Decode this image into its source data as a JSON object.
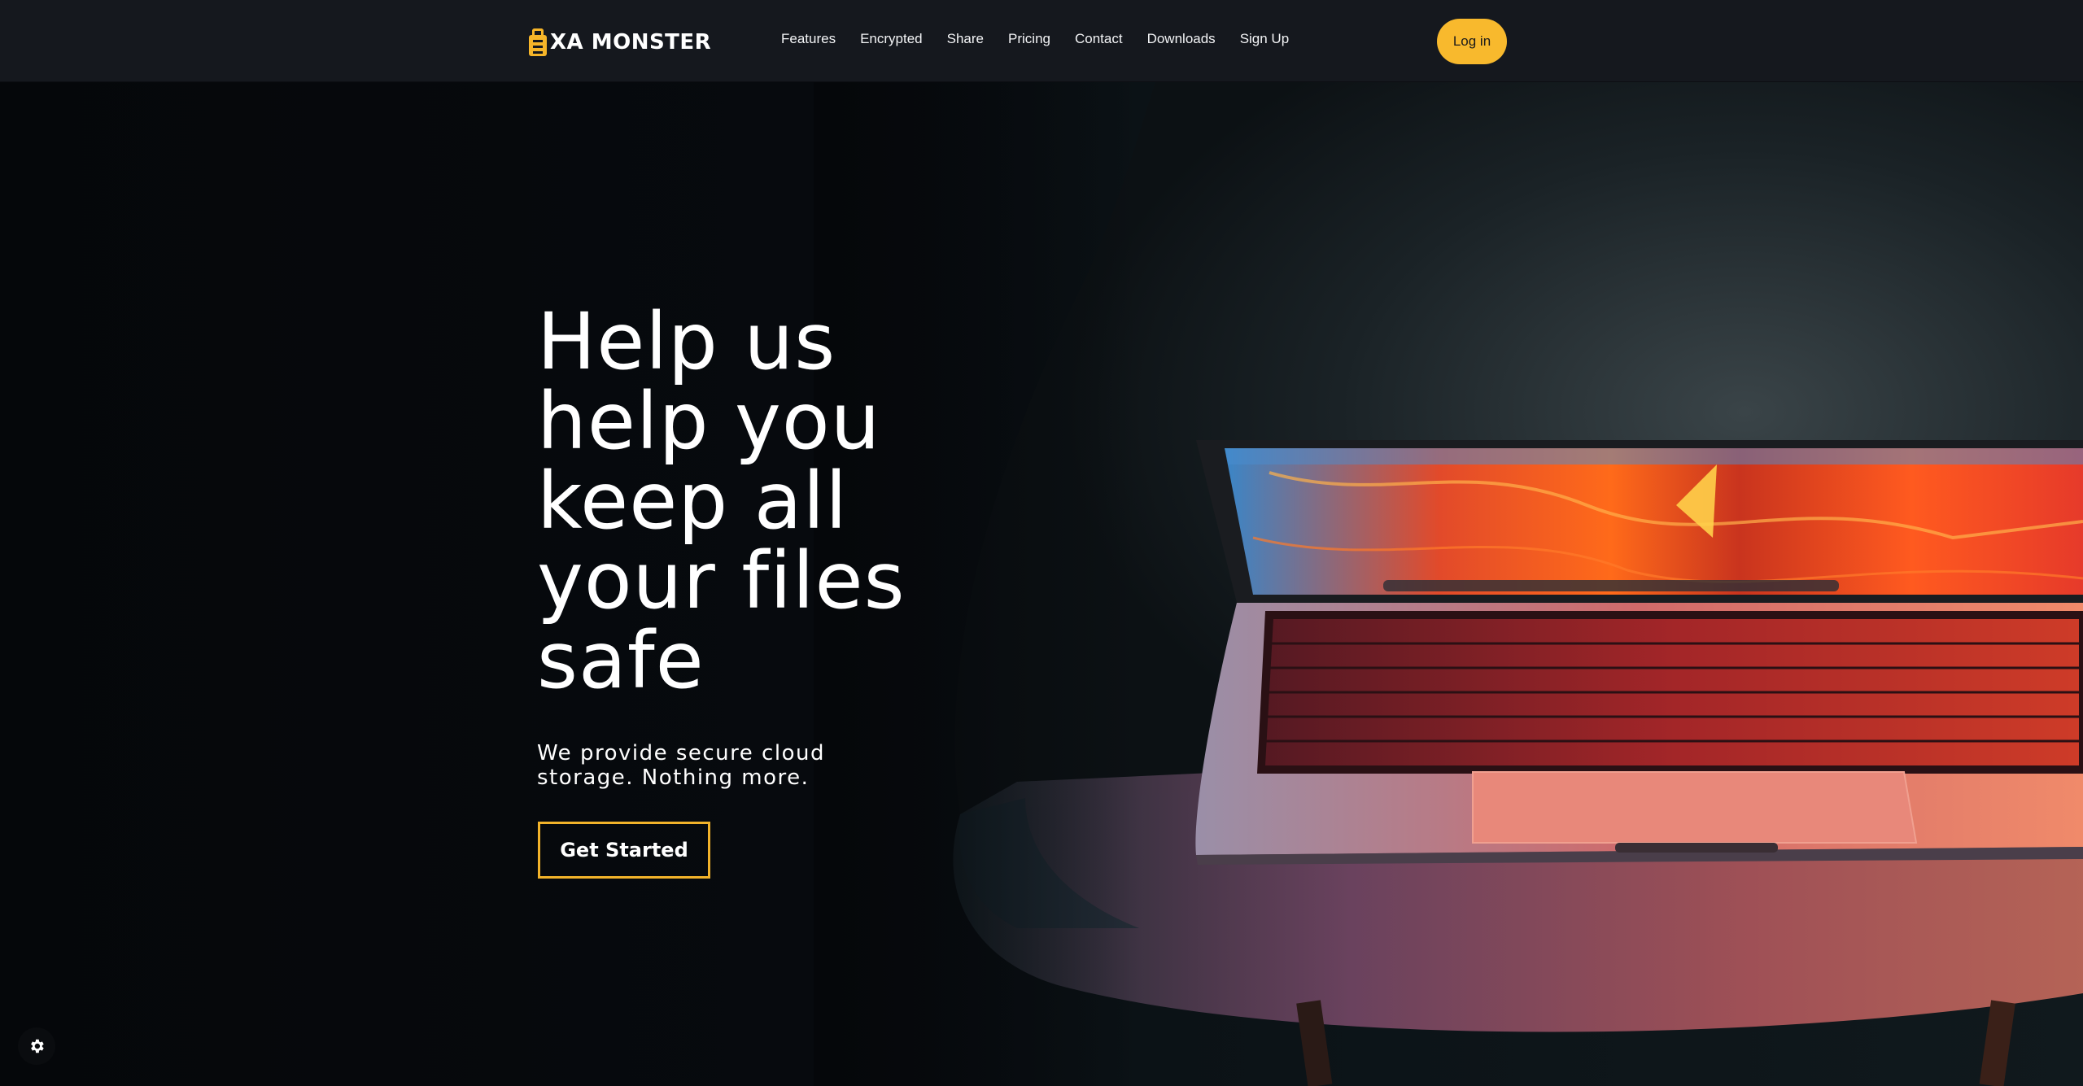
{
  "brand": {
    "name": "XA MONSTER",
    "accent": "#f8b92d"
  },
  "nav": {
    "links": [
      "Features",
      "Encrypted",
      "Share",
      "Pricing",
      "Contact",
      "Downloads",
      "Sign Up"
    ],
    "login_label": "Log in"
  },
  "hero": {
    "title_lines": [
      "Help us",
      "help you",
      "keep all",
      "your files",
      "safe"
    ],
    "subtitle": "We provide secure cloud storage. Nothing more.",
    "cta_label": "Get Started"
  },
  "icons": {
    "cookie_settings": "gear-icon"
  },
  "colors": {
    "nav_bg": "#15181e",
    "hero_bg": "#07090c",
    "cta_border": "#f2b32a"
  }
}
